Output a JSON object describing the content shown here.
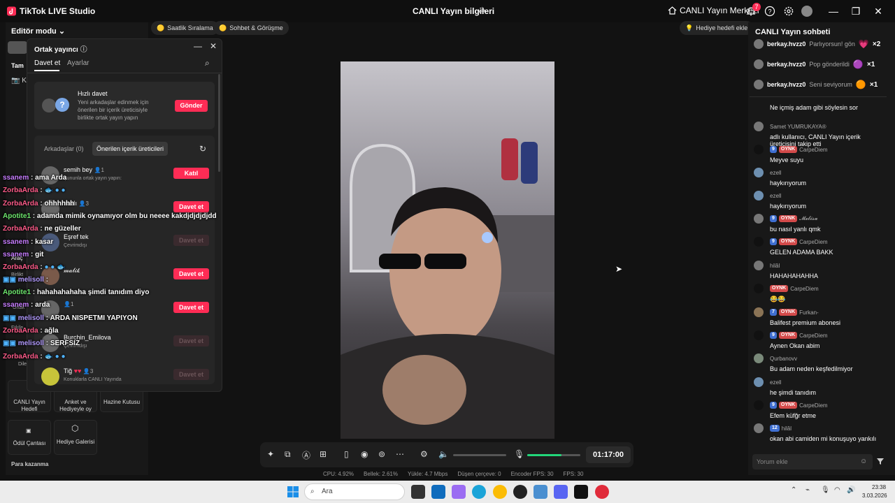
{
  "titlebar": {
    "app_title": "TikTok LIVE Studio",
    "center_title": "CANLI Yayın bilgileri",
    "live_center": "CANLI Yayın Merkezi",
    "notif_count": "7"
  },
  "left": {
    "editor_mode": "Editör modu",
    "tam": "Tam",
    "k": "K",
    "arac": "Araç",
    "birlikte": "Birlikt",
    "ortak": "Ortak",
    "etkile": "Etkile",
    "dile": "Dile",
    "tools": [
      {
        "label": "CANLI Yayın Hedefi"
      },
      {
        "label": "Anket ve Hediyeyle oy"
      },
      {
        "label": "Hazine Kutusu"
      },
      {
        "label": "Ödül Çantası"
      },
      {
        "label": "Hediye Galerisi"
      }
    ],
    "earn": "Para kazanma"
  },
  "pills": {
    "hourly": "Saatlik Sıralama",
    "chat": "Sohbet & Görüşme",
    "gift_goal": "Hediye hedefi ekle"
  },
  "modal": {
    "title": "Ortak yayıncı",
    "tab_invite": "Davet et",
    "tab_settings": "Ayarlar",
    "quick_title": "Hızlı davet",
    "quick_desc": "Yeni arkadaşlar edinmek için önerilen bir içerik üreticisiyle birlikte ortak yayın yapın",
    "send": "Gönder",
    "tab_friends": "Arkadaşlar (0)",
    "tab_suggested": "Önerilen içerik üreticileri",
    "users": [
      {
        "name": "semih bey",
        "count": "1",
        "sub": "Şununla ortak yayın yapın:",
        "btn": "Katıl",
        "active": true
      },
      {
        "name": "nazlı",
        "count": "3",
        "sub": "",
        "btn": "Davet et",
        "active": true
      },
      {
        "name": "Eşref tek",
        "count": "",
        "sub": "Çevrimdışı",
        "btn": "Davet et",
        "active": false
      },
      {
        "name": "𝓂𝒶𝓁𝒾𝓀",
        "count": "",
        "sub": "",
        "btn": "Davet et",
        "active": true
      },
      {
        "name": "",
        "count": "1",
        "sub": "",
        "btn": "Davet et",
        "active": true
      },
      {
        "name": "Burchin_Emilova",
        "count": "",
        "sub": "Çevrimdışı",
        "btn": "Davet et",
        "active": false
      },
      {
        "name": "Tiğ",
        "count": "3",
        "sub": "Konuklarla CANLI Yayında",
        "btn": "Davet et",
        "active": false
      }
    ]
  },
  "overlay_chat": [
    {
      "user": "ssanem",
      "msg": "ama Arda"
    },
    {
      "user": "ZorbaArda",
      "msg": ""
    },
    {
      "user": "ZorbaArda",
      "msg": "ohhhhhh"
    },
    {
      "user": "Apotite1",
      "msg": "adamda mimik oynamıyor olm bu neeee kakdjdjdjdjdd"
    },
    {
      "user": "ZorbaArda",
      "msg": "ne güzeller"
    },
    {
      "user": "ssanem",
      "msg": "kasar"
    },
    {
      "user": "ssanem",
      "msg": "git"
    },
    {
      "user": "ZorbaArda",
      "msg": ""
    },
    {
      "user": "melisoll",
      "msg": ""
    },
    {
      "user": "Apotite1",
      "msg": "hahahahahaha şimdi tanıdım diyo"
    },
    {
      "user": "ssanem",
      "msg": "arda"
    },
    {
      "user": "melisoll",
      "msg": "ARDA NISPETMI YAPIYON"
    },
    {
      "user": "ZorbaArda",
      "msg": "ağla"
    },
    {
      "user": "melisoll",
      "msg": "SERFSIZ"
    },
    {
      "user": "ZorbaArda",
      "msg": ""
    }
  ],
  "stream": {
    "timer": "01:17:00",
    "stats": [
      "CPU: 4.92%",
      "Bellek: 2.61%",
      "Yükle: 4.7 Mbps",
      "Düşen çerçeve: 0",
      "Encoder FPS: 30",
      "FPS: 30"
    ]
  },
  "chat": {
    "title": "CANLI Yayın sohbeti",
    "gifts": [
      {
        "user": "berkay.hvzz0",
        "text": "Parlıyorsun! gön",
        "count": "×2"
      },
      {
        "user": "berkay.hvzz0",
        "text": "Pop gönderildi",
        "count": "×1"
      },
      {
        "user": "berkay.hvzz0",
        "text": "Seni seviyorum",
        "count": "×1"
      }
    ],
    "messages": [
      {
        "user": "",
        "lvl": "",
        "fan": "",
        "text": "Ne içmiş adam gibi söylesin sor"
      },
      {
        "user": "Samet YUMRUKAYA®",
        "lvl": "",
        "fan": "",
        "text": "adlı kullanıcı, CANLI Yayın içerik üreticisini takip etti"
      },
      {
        "user": "CarpeDiem",
        "lvl": "9",
        "fan": "OYNK",
        "text": "Meyve suyu"
      },
      {
        "user": "ezell",
        "lvl": "",
        "fan": "",
        "text": "haykırıyorum"
      },
      {
        "user": "ezell",
        "lvl": "",
        "fan": "",
        "text": "haykırıyorum"
      },
      {
        "user": "𝓜𝓮𝓵𝓲𝓼𝓪",
        "lvl": "9",
        "fan": "OYNK",
        "text": "bu nasıl yanlı qmk"
      },
      {
        "user": "CarpeDiem",
        "lvl": "9",
        "fan": "OYNK",
        "text": "GELEN ADAMA BAKK"
      },
      {
        "user": "hilâl",
        "lvl": "",
        "fan": "",
        "text": "HAHAHAHAHHA"
      },
      {
        "user": "CarpeDiem",
        "lvl": "",
        "fan": "OYNK",
        "text": "😂😂"
      },
      {
        "user": "Furkan-",
        "lvl": "7",
        "fan": "OYNK",
        "text": "Balifest premium abonesi"
      },
      {
        "user": "CarpeDiem",
        "lvl": "9",
        "fan": "OYNK",
        "text": "Aynen Okan abim"
      },
      {
        "user": "Qurbanovv",
        "lvl": "",
        "fan": "",
        "text": "Bu adam neden keşfedilmiyor"
      },
      {
        "user": "ezell",
        "lvl": "",
        "fan": "",
        "text": "he şimdi tanıdım"
      },
      {
        "user": "CarpeDiem",
        "lvl": "9",
        "fan": "OYNK",
        "text": "Efem küfğr etme"
      },
      {
        "user": "hilâl",
        "lvl": "12",
        "fan": "",
        "text": "okan abi camiden mi konuşuyo yankılı"
      }
    ],
    "comment_placeholder": "Yorum ekle"
  },
  "taskbar": {
    "search": "Ara",
    "time": "23:38",
    "date": "3.03.2026"
  },
  "colors": {
    "accent": "#fe2c55",
    "chat_level": "#3f6fd1"
  }
}
